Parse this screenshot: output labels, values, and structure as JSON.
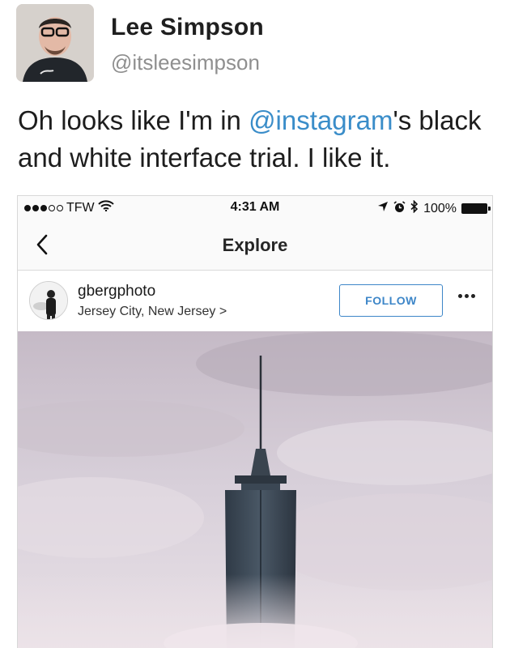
{
  "tweet": {
    "author_name": "Lee Simpson",
    "author_handle": "@itsleesimpson",
    "text_before": "Oh looks like I'm in ",
    "mention": "@instagram",
    "text_after": "'s black and white interface trial. I like it.",
    "mention_color": "#3a8dc9"
  },
  "status_bar": {
    "carrier": "TFW",
    "time": "4:31 AM",
    "battery": "100%"
  },
  "nav": {
    "title": "Explore"
  },
  "post": {
    "username": "gbergphoto",
    "location": "Jersey City, New Jersey",
    "location_chevron": ">",
    "follow_label": "FOLLOW",
    "follow_color": "#3d86c8"
  },
  "icons": {
    "back": "chevron-left-icon",
    "wifi": "wifi-icon",
    "location_arrow": "location-arrow-icon",
    "alarm": "alarm-icon",
    "bluetooth": "bluetooth-icon",
    "battery": "battery-icon",
    "more": "more-dots-icon"
  }
}
